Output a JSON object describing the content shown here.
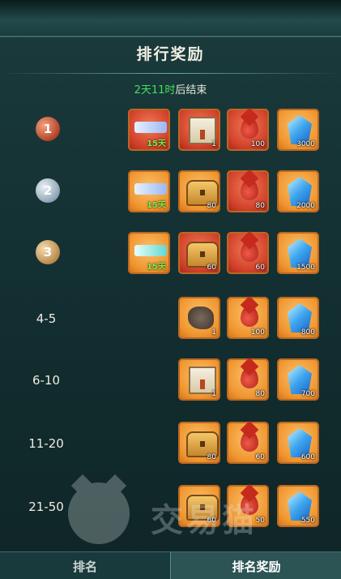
{
  "header": {
    "title": "排行奖励",
    "timer_value": "2天11时",
    "timer_suffix": "后结束"
  },
  "tabs": {
    "ranking": "排名",
    "rewards": "排名奖励"
  },
  "watermark": {
    "text": "交易猫"
  },
  "rows": [
    {
      "rank": "1",
      "medal": "gold",
      "items": [
        {
          "kind": "flag-red",
          "bg": "red",
          "label": "15天"
        },
        {
          "kind": "box",
          "bg": "red",
          "count": "1"
        },
        {
          "kind": "drop",
          "bg": "red",
          "count": "100"
        },
        {
          "kind": "crystal",
          "bg": "orange",
          "count": "3000"
        }
      ]
    },
    {
      "rank": "2",
      "medal": "silver",
      "items": [
        {
          "kind": "flag",
          "bg": "orange",
          "label": "15天"
        },
        {
          "kind": "chest",
          "bg": "orange",
          "count": "80"
        },
        {
          "kind": "drop",
          "bg": "red",
          "count": "80"
        },
        {
          "kind": "crystal",
          "bg": "orange",
          "count": "2000"
        }
      ]
    },
    {
      "rank": "3",
      "medal": "bronze",
      "items": [
        {
          "kind": "flag-teal",
          "bg": "orange",
          "label": "15天"
        },
        {
          "kind": "chest",
          "bg": "red",
          "count": "60"
        },
        {
          "kind": "drop",
          "bg": "red",
          "count": "60"
        },
        {
          "kind": "crystal",
          "bg": "orange",
          "count": "1500"
        }
      ]
    },
    {
      "rank": "4-5",
      "items": [
        {
          "kind": "stone",
          "bg": "orange",
          "count": "1"
        },
        {
          "kind": "drop",
          "bg": "orange",
          "count": "100"
        },
        {
          "kind": "crystal",
          "bg": "orange",
          "count": "800"
        }
      ]
    },
    {
      "rank": "6-10",
      "items": [
        {
          "kind": "box",
          "bg": "orange",
          "count": "1"
        },
        {
          "kind": "drop",
          "bg": "orange",
          "count": "80"
        },
        {
          "kind": "crystal",
          "bg": "orange",
          "count": "700"
        }
      ]
    },
    {
      "rank": "11-20",
      "items": [
        {
          "kind": "chest",
          "bg": "orange",
          "count": "80"
        },
        {
          "kind": "drop",
          "bg": "orange",
          "count": "60"
        },
        {
          "kind": "crystal",
          "bg": "orange",
          "count": "600"
        }
      ]
    },
    {
      "rank": "21-50",
      "items": [
        {
          "kind": "chest",
          "bg": "orange",
          "count": "60"
        },
        {
          "kind": "drop",
          "bg": "orange",
          "count": "50"
        },
        {
          "kind": "crystal",
          "bg": "orange",
          "count": "550"
        }
      ]
    }
  ]
}
